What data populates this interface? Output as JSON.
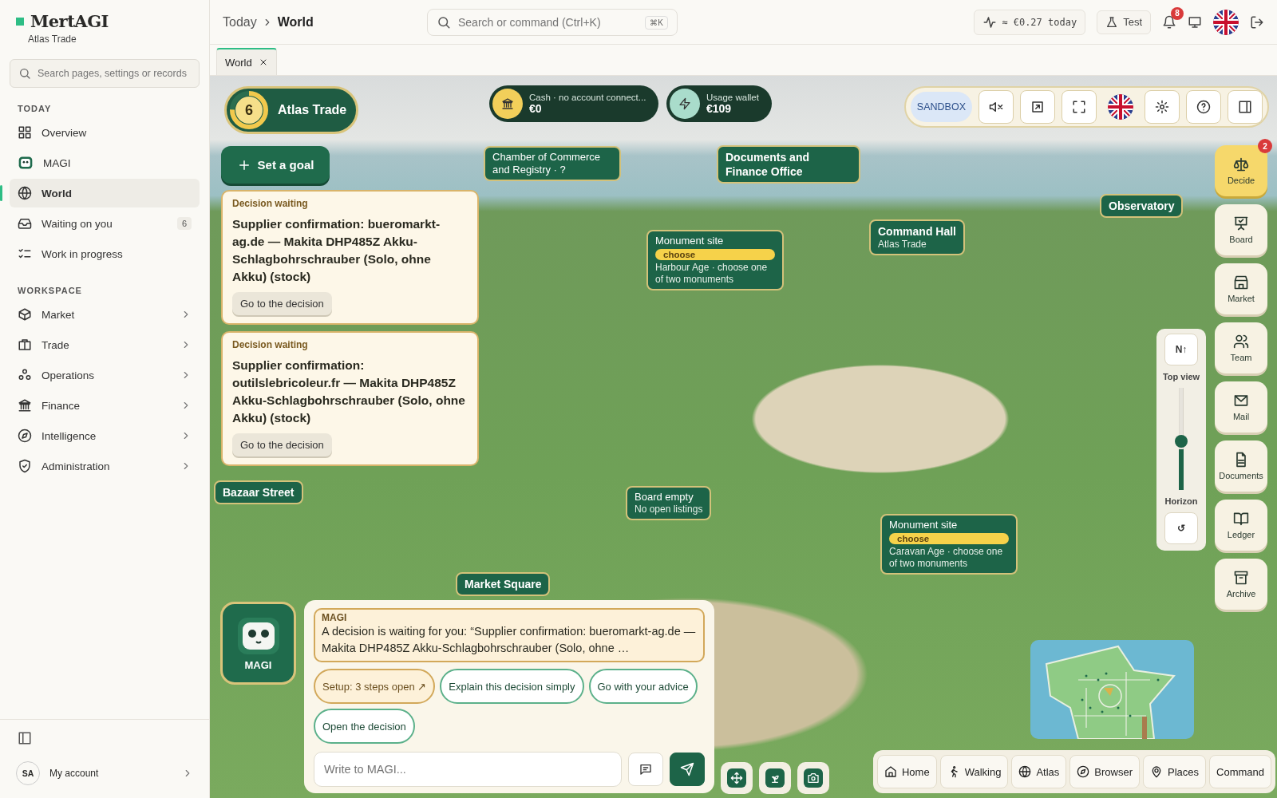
{
  "topbar": {
    "breadcrumb": [
      "Today",
      "World"
    ],
    "search": {
      "placeholder": "Search or command (Ctrl+K)",
      "shortcut": "⌘K"
    },
    "cost": "≈ €0.27 today",
    "test_button": "Test",
    "notifications": "8"
  },
  "sidebar": {
    "brand": "MertAGI",
    "org": "Atlas Trade",
    "search": {
      "placeholder": "Search pages, settings or records"
    },
    "sections": [
      {
        "title": "TODAY",
        "items": [
          {
            "label": "Overview",
            "selected": false
          },
          {
            "label": "MAGI",
            "selected": false
          },
          {
            "label": "World",
            "selected": true
          },
          {
            "label": "Waiting on you",
            "selected": false,
            "count": "6"
          },
          {
            "label": "Work in progress",
            "selected": false
          }
        ]
      },
      {
        "title": "WORKSPACE",
        "items": [
          {
            "label": "Market",
            "selected": false,
            "expanded": false
          },
          {
            "label": "Trade",
            "selected": false,
            "expanded": false
          },
          {
            "label": "Operations",
            "selected": false,
            "expanded": false
          },
          {
            "label": "Finance",
            "selected": false,
            "expanded": false
          },
          {
            "label": "Intelligence",
            "selected": false,
            "expanded": false
          },
          {
            "label": "Administration",
            "selected": false,
            "expanded": false
          }
        ]
      }
    ],
    "account": {
      "initials": "SA",
      "label": "My account"
    }
  },
  "tabs": [
    {
      "label": "World",
      "selected": true
    }
  ],
  "world": {
    "player": {
      "number": "6",
      "name": "Atlas Trade",
      "level": 0.75
    },
    "wallets": [
      {
        "kind": "cash",
        "label": "Cash · no account connect...",
        "value": "€0"
      },
      {
        "kind": "usage",
        "label": "Usage wallet",
        "value": "€109"
      }
    ],
    "goal_button": "Set a goal",
    "decisions": [
      {
        "label": "Decision waiting",
        "title": "Supplier confirmation: bueromarkt-ag.de — Makita DHP485Z Akku-Schlagbohrschrauber (Solo, ohne Akku) (stock)",
        "button": "Go to the decision"
      },
      {
        "label": "Decision waiting",
        "title": "Supplier confirmation: outilslebricoleur.fr — Makita DHP485Z Akku-Schlagbohrschrauber (Solo, ohne Akku) (stock)",
        "button": "Go to the decision"
      }
    ],
    "places": [
      {
        "kind": "plain",
        "title": "Chamber of Commerce and Registry · ?"
      },
      {
        "kind": "heading",
        "title": "Documents and Finance Office"
      },
      {
        "kind": "heading",
        "title": "Observatory"
      },
      {
        "kind": "heading",
        "title": "Command Hall",
        "subtitle": "Atlas Trade"
      },
      {
        "kind": "monument",
        "title": "Monument site",
        "tag": "choose",
        "subtitle": "Harbour Age · choose one of two monuments"
      },
      {
        "kind": "heading",
        "title": "Bazaar Street"
      },
      {
        "kind": "plain",
        "title": "Board empty",
        "subtitle": "No open listings"
      },
      {
        "kind": "monument",
        "title": "Monument site",
        "tag": "choose",
        "subtitle": "Caravan Age · choose one of two monuments"
      },
      {
        "kind": "heading",
        "title": "Market Square"
      }
    ],
    "mode": "SANDBOX",
    "dock": [
      {
        "label": "Decide",
        "selected": true,
        "badge": "2"
      },
      {
        "label": "Board",
        "selected": false
      },
      {
        "label": "Market",
        "selected": false
      },
      {
        "label": "Team",
        "selected": false
      },
      {
        "label": "Mail",
        "selected": false
      },
      {
        "label": "Documents",
        "selected": false
      },
      {
        "label": "Ledger",
        "selected": false
      },
      {
        "label": "Archive",
        "selected": false
      }
    ],
    "camera": {
      "north": "N↑",
      "top_label": "Top view",
      "bottom_label": "Horizon",
      "level": 0.4,
      "reset": "↺"
    },
    "assistant": {
      "name": "MAGI",
      "sender": "MAGI",
      "message": "A decision is waiting for you: “Supplier confirmation: bueromarkt-ag.de — Makita DHP485Z Akku-Schlagbohrschrauber (Solo, ohne …",
      "chips": [
        {
          "kind": "setup",
          "label": "Setup: 3 steps open ↗"
        },
        {
          "kind": "action",
          "label": "Explain this decision simply"
        },
        {
          "kind": "action",
          "label": "Go with your advice"
        },
        {
          "kind": "action",
          "label": "Open the decision"
        }
      ],
      "input": {
        "placeholder": "Write to MAGI..."
      }
    },
    "nav": [
      "Home",
      "Walking",
      "Atlas",
      "Browser",
      "Places",
      "Command"
    ]
  }
}
